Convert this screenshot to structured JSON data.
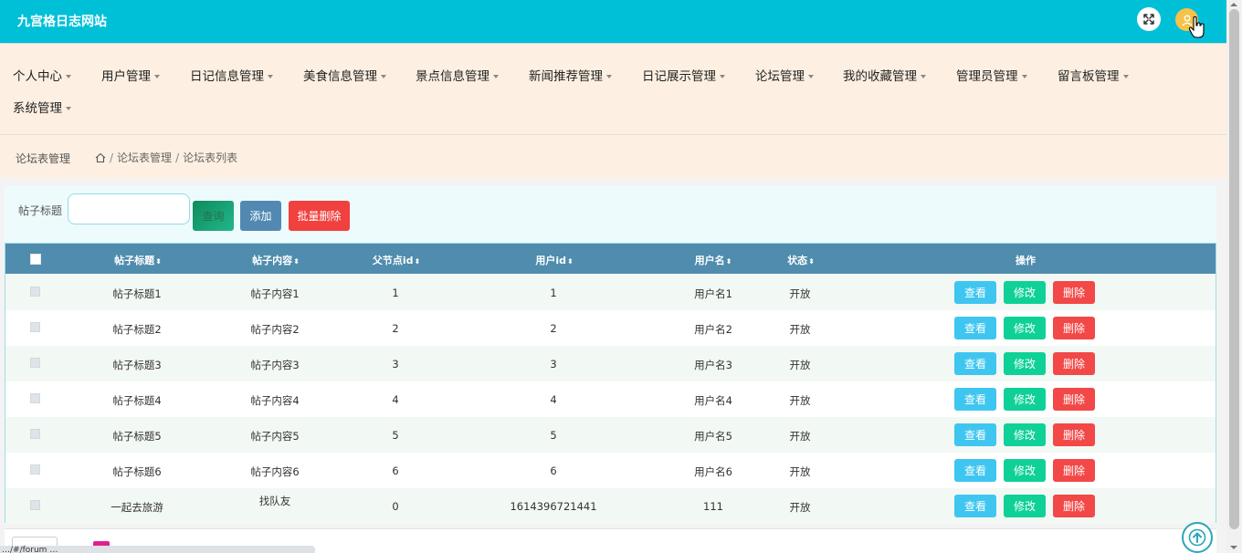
{
  "header": {
    "site_title": "九宫格日志网站"
  },
  "nav": {
    "items": [
      {
        "label": "个人中心"
      },
      {
        "label": "用户管理"
      },
      {
        "label": "日记信息管理"
      },
      {
        "label": "美食信息管理"
      },
      {
        "label": "景点信息管理"
      },
      {
        "label": "新闻推荐管理"
      },
      {
        "label": "日记展示管理"
      },
      {
        "label": "论坛管理"
      },
      {
        "label": "我的收藏管理"
      },
      {
        "label": "管理员管理"
      },
      {
        "label": "留言板管理"
      },
      {
        "label": "系统管理"
      }
    ]
  },
  "breadcrumb": {
    "title": "论坛表管理",
    "sep": "/",
    "level1": "论坛表管理",
    "level2": "论坛表列表"
  },
  "search": {
    "label": "帖子标题",
    "input_value": "",
    "input_placeholder": "",
    "search_btn": "查询",
    "add_btn": "添加",
    "batch_delete_btn": "批量删除"
  },
  "table": {
    "columns": [
      "帖子标题",
      "帖子内容",
      "父节点id",
      "用户id",
      "用户名",
      "状态",
      "操作"
    ],
    "sort_glyph": "⬍",
    "actions": {
      "view": "查看",
      "edit": "修改",
      "delete": "删除"
    },
    "rows": [
      {
        "title": "帖子标题1",
        "content": "帖子内容1",
        "parent_id": "1",
        "user_id": "1",
        "username": "用户名1",
        "status": "开放"
      },
      {
        "title": "帖子标题2",
        "content": "帖子内容2",
        "parent_id": "2",
        "user_id": "2",
        "username": "用户名2",
        "status": "开放"
      },
      {
        "title": "帖子标题3",
        "content": "帖子内容3",
        "parent_id": "3",
        "user_id": "3",
        "username": "用户名3",
        "status": "开放"
      },
      {
        "title": "帖子标题4",
        "content": "帖子内容4",
        "parent_id": "4",
        "user_id": "4",
        "username": "用户名4",
        "status": "开放"
      },
      {
        "title": "帖子标题5",
        "content": "帖子内容5",
        "parent_id": "5",
        "user_id": "5",
        "username": "用户名5",
        "status": "开放"
      },
      {
        "title": "帖子标题6",
        "content": "帖子内容6",
        "parent_id": "6",
        "user_id": "6",
        "username": "用户名6",
        "status": "开放"
      },
      {
        "title": "一起去旅游",
        "content": "找队友",
        "parent_id": "0",
        "user_id": "1614396721441",
        "username": "111",
        "status": "开放"
      }
    ]
  },
  "status_bar": {
    "url": "…/#/forum …"
  },
  "colors": {
    "topbar": "#00c0d8",
    "navbar": "#fdf0e2",
    "table_header": "#4f8cad",
    "view_btn": "#3fc6f0",
    "edit_btn": "#0fd197",
    "delete_btn": "#f24848"
  },
  "icons": {
    "fullscreen": "expand-icon",
    "avatar": "user-avatar-icon",
    "home": "home-icon",
    "back_to_top": "arrow-up-icon",
    "cursor": "hand-pointer-icon"
  }
}
